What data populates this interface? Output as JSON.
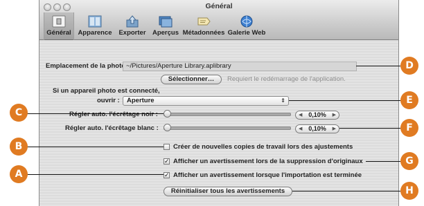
{
  "window": {
    "title": "Général"
  },
  "toolbar": {
    "items": [
      {
        "label": "Général",
        "icon": "switch-icon",
        "selected": true
      },
      {
        "label": "Apparence",
        "icon": "appearance-icon"
      },
      {
        "label": "Exporter",
        "icon": "export-icon"
      },
      {
        "label": "Aperçus",
        "icon": "previews-icon"
      },
      {
        "label": "Métadonnées",
        "icon": "metadata-icon"
      },
      {
        "label": "Galerie Web",
        "icon": "web-gallery-icon"
      }
    ]
  },
  "library": {
    "label": "Emplacement de la photothèque :",
    "path": "~/Pictures/Aperture Library.aplibrary",
    "choose_button": "Sélectionner…",
    "restart_note": "Requiert le redémarrage de l'application."
  },
  "camera": {
    "label_line1": "Si un appareil photo est connecté,",
    "label_line2": "ouvrir :",
    "selected": "Aperture"
  },
  "black_clip": {
    "label": "Régler auto. l'écrêtage noir :",
    "value": "0,10%",
    "slider_fraction": 0.0
  },
  "white_clip": {
    "label": "Régler auto. l'écrêtage blanc :",
    "value": "0,10%",
    "slider_fraction": 0.0
  },
  "options": {
    "new_versions": {
      "label": "Créer de nouvelles copies de travail lors des ajustements",
      "checked": false
    },
    "warn_delete": {
      "label": "Afficher un avertissement lors de la suppression d'originaux",
      "checked": true
    },
    "warn_import": {
      "label": "Afficher un avertissement lorsque l'importation est terminée",
      "checked": true
    }
  },
  "reset_button": "Réinitialiser tous les avertissements",
  "callouts": {
    "A": "A",
    "B": "B",
    "C": "C",
    "D": "D",
    "E": "E",
    "F": "F",
    "G": "G",
    "H": "H"
  },
  "colors": {
    "callout": "#e07b22",
    "window_bg": "#dedede"
  },
  "glyphs": {
    "check": "✓",
    "arrows": "⇕",
    "left": "◀",
    "right": "▶"
  }
}
